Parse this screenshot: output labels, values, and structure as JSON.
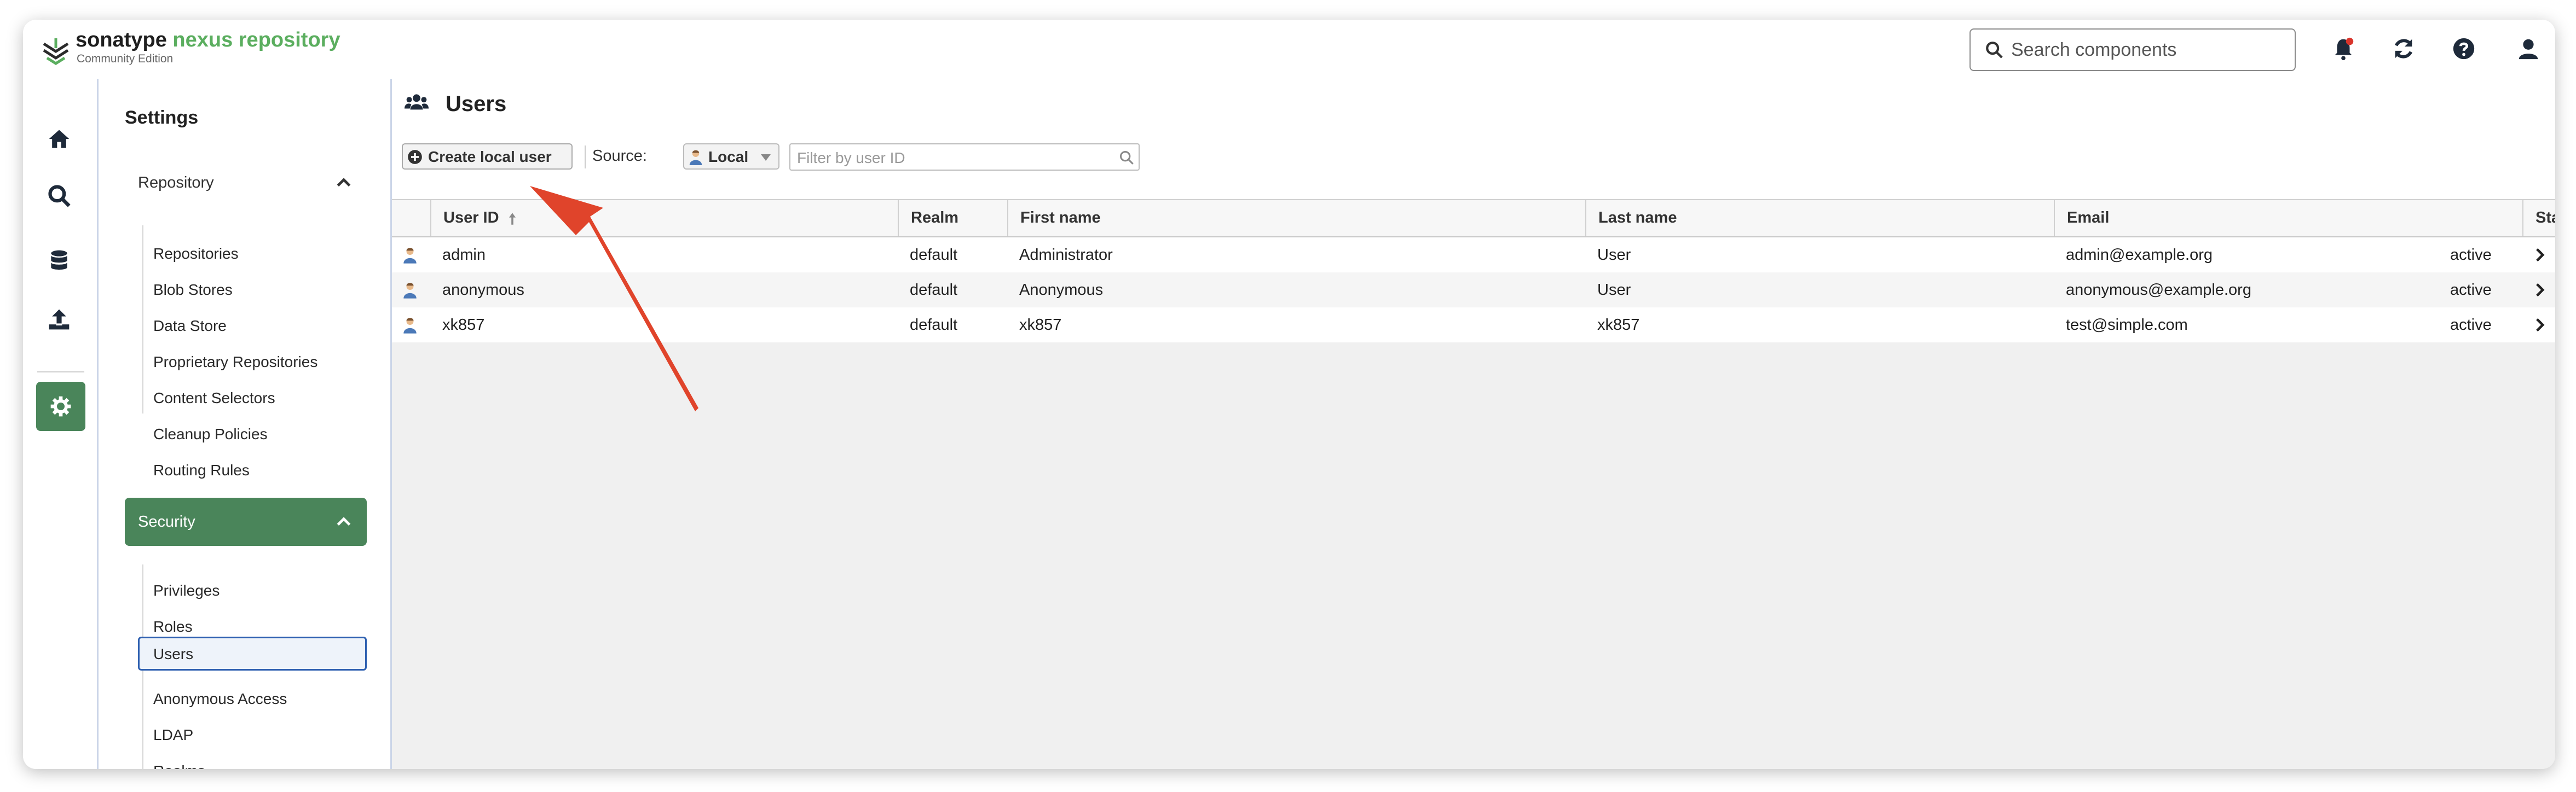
{
  "brand": {
    "name_part1": "sonatype",
    "name_part2": " nexus repository",
    "edition": "Community Edition"
  },
  "header": {
    "search_placeholder": "Search components",
    "icons": [
      "bell-icon",
      "refresh-icon",
      "help-icon",
      "user-icon"
    ]
  },
  "rail": {
    "icons": [
      "home-icon",
      "search-icon",
      "database-icon",
      "upload-icon",
      "settings-icon"
    ]
  },
  "nav": {
    "title": "Settings",
    "repository_group": "Repository",
    "repository_items": [
      "Repositories",
      "Blob Stores",
      "Data Store",
      "Proprietary Repositories",
      "Content Selectors",
      "Cleanup Policies",
      "Routing Rules"
    ],
    "security_group": "Security",
    "security_items": [
      "Privileges",
      "Roles",
      "Users",
      "Anonymous Access",
      "LDAP",
      "Realms"
    ]
  },
  "page": {
    "title": "Users",
    "create_button": "Create local user",
    "source_label": "Source:",
    "source_value": "Local",
    "filter_placeholder": "Filter by user ID"
  },
  "table": {
    "columns": [
      "User ID",
      "Realm",
      "First name",
      "Last name",
      "Email",
      "Status"
    ],
    "rows": [
      {
        "user_id": "admin",
        "realm": "default",
        "first": "Administrator",
        "last": "User",
        "email": "admin@example.org",
        "status": "active"
      },
      {
        "user_id": "anonymous",
        "realm": "default",
        "first": "Anonymous",
        "last": "User",
        "email": "anonymous@example.org",
        "status": "active"
      },
      {
        "user_id": "xk857",
        "realm": "default",
        "first": "xk857",
        "last": "xk857",
        "email": "test@simple.com",
        "status": "active"
      }
    ]
  },
  "colors": {
    "accent_green": "#4a855a",
    "brand_green": "#5bae5f",
    "annotation_arrow": "#e0442b",
    "selection_blue": "#2d5fb0"
  }
}
